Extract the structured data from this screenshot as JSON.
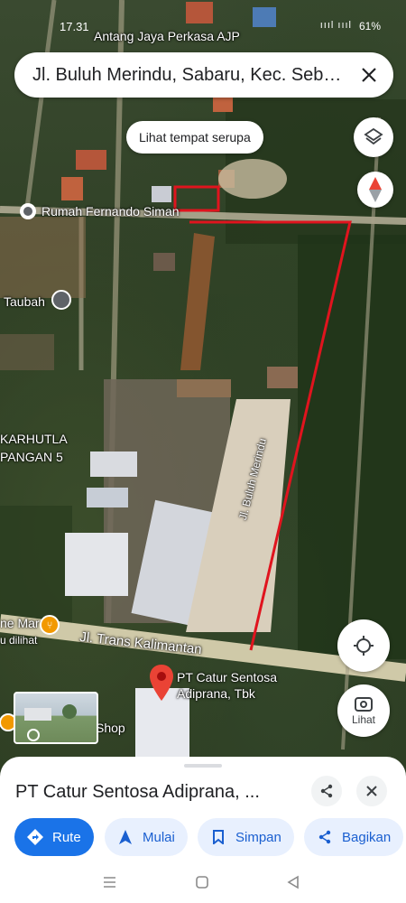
{
  "status_bar": {
    "time": "17.31",
    "battery": "61%",
    "signal": "ıııl ıııl"
  },
  "search": {
    "query": "Jl. Buluh Merindu, Sabaru, Kec. Seb…"
  },
  "chip": {
    "label": "Lihat tempat serupa"
  },
  "map": {
    "labels": {
      "antang": "Antang Jaya Perkasa AJP",
      "rumah": "Rumah Fernando Siman",
      "taubah": "Taubah",
      "karhutla": "KARHUTLA",
      "pangan": "PANGAN 5",
      "trans": "Jl. Trans Kalimantan",
      "buluh": "Jl. Buluh Merindu",
      "mar": "ne Mar",
      "dilihat": "u dilihat",
      "shop": "Shop",
      "pt_line1": "PT Catur Sentosa",
      "pt_line2": "Adiprana, Tbk"
    },
    "lihat_label": "Lihat"
  },
  "sheet": {
    "title": "PT Catur Sentosa Adiprana, ...",
    "actions": {
      "rute": "Rute",
      "mulai": "Mulai",
      "simpan": "Simpan",
      "bagikan": "Bagikan"
    }
  },
  "colors": {
    "accent": "#1a73e8",
    "annotation": "#e0141e",
    "pin": "#ea4335"
  }
}
